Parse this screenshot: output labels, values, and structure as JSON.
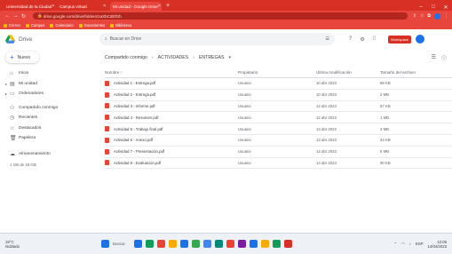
{
  "browser": {
    "tabs": [
      {
        "title": "Universidad de la Ciudad",
        "active": false
      },
      {
        "title": "Campus virtual",
        "active": false
      },
      {
        "title": "Mi unidad - Google Drive",
        "active": true
      }
    ],
    "new_tab": "+",
    "url": "drive.google.com/drive/folders/1aXbCdEfGh",
    "window_controls": [
      "–",
      "□",
      "✕"
    ]
  },
  "bookmarks": [
    "Correo",
    "Campus",
    "Calendario",
    "Documentos",
    "Biblioteca"
  ],
  "drive": {
    "app_name": "Drive",
    "search_placeholder": "Buscar en Drive",
    "badge": "Workspace"
  },
  "sidebar": {
    "new_label": "Nuevo",
    "items": [
      {
        "label": "Inicio",
        "icon": "home-icon",
        "caret": ""
      },
      {
        "label": "Mi unidad",
        "icon": "folder-icon",
        "caret": "▸"
      },
      {
        "label": "Ordenadores",
        "icon": "computer-icon",
        "caret": "▸"
      },
      {
        "label": "Compartido conmigo",
        "icon": "people-icon",
        "caret": ""
      },
      {
        "label": "Recientes",
        "icon": "clock-icon",
        "caret": ""
      },
      {
        "label": "Destacados",
        "icon": "star-icon",
        "caret": ""
      },
      {
        "label": "Papelera",
        "icon": "trash-icon",
        "caret": ""
      },
      {
        "label": "Almacenamiento",
        "icon": "cloud-icon",
        "caret": ""
      }
    ],
    "storage_text": "1 GB de 15 GB"
  },
  "main": {
    "breadcrumbs": [
      "Compartido conmigo",
      "ACTIVIDADES",
      "ENTREGAS"
    ],
    "columns": [
      "Nombre",
      "Propietario",
      "Última modificación",
      "Tamaño del archivo"
    ],
    "files": [
      {
        "name": "Actividad 1 - Entrega.pdf",
        "owner": "Usuario",
        "modified": "10 abr 2023",
        "size": "88 KB"
      },
      {
        "name": "Actividad 2 - Entrega.pdf",
        "owner": "Usuario",
        "modified": "10 abr 2023",
        "size": "2 MB"
      },
      {
        "name": "Actividad 3 - Informe.pdf",
        "owner": "Usuario",
        "modified": "12 abr 2023",
        "size": "67 KB"
      },
      {
        "name": "Actividad 4 - Resumen.pdf",
        "owner": "Usuario",
        "modified": "12 abr 2023",
        "size": "1 MB"
      },
      {
        "name": "Actividad 5 - Trabajo final.pdf",
        "owner": "Usuario",
        "modified": "13 abr 2023",
        "size": "3 MB"
      },
      {
        "name": "Actividad 6 - Anexo.pdf",
        "owner": "Usuario",
        "modified": "13 abr 2023",
        "size": "44 KB"
      },
      {
        "name": "Actividad 7 - Presentación.pdf",
        "owner": "Usuario",
        "modified": "14 abr 2023",
        "size": "5 MB"
      },
      {
        "name": "Actividad 8 - Evaluación.pdf",
        "owner": "Usuario",
        "modified": "14 abr 2023",
        "size": "90 KB"
      }
    ]
  },
  "taskbar": {
    "weather_temp": "19°C",
    "weather_desc": "Nublado",
    "search_label": "Buscar",
    "app_colors": [
      "#1a73e8",
      "#0f9d58",
      "#ea4335",
      "#f9ab00",
      "#1a73e8",
      "#34a853",
      "#4285f4",
      "#00897b",
      "#ea4335",
      "#7b1fa2",
      "#1a73e8",
      "#f9ab00",
      "#0f9d58",
      "#d93025"
    ],
    "time": "12:05",
    "date": "14/04/2023",
    "lang": "ESP"
  },
  "colors": {
    "browser_accent": "#d93025",
    "folder_blue": "#1a73e8",
    "pdf_red": "#ea4335"
  }
}
